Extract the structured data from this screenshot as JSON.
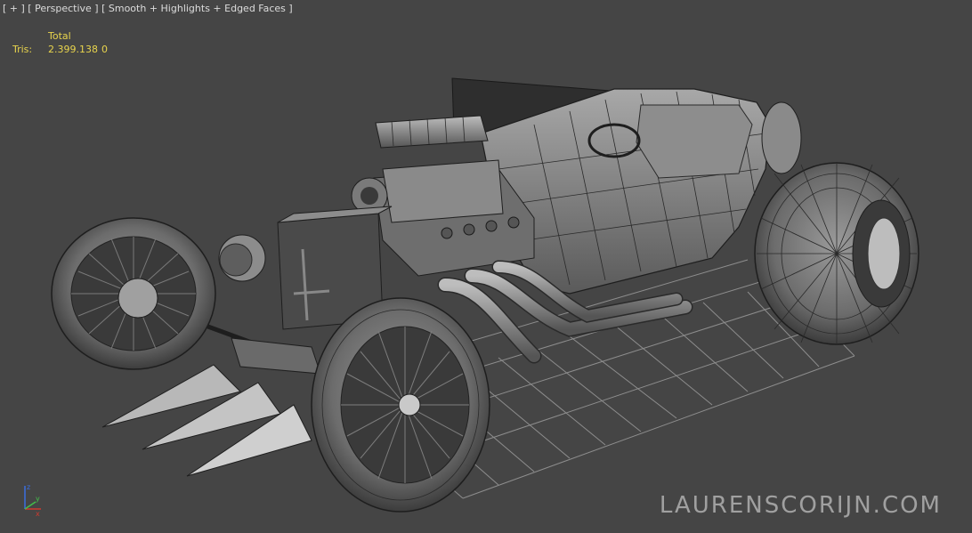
{
  "viewport": {
    "label": {
      "plus": "[ + ]",
      "view": "[ Perspective ]",
      "shading": "[ Smooth + Highlights + Edged Faces ]"
    },
    "stats": {
      "header": "Total",
      "tris_label": "Tris:",
      "tris_total": "2.399.138",
      "tris_selected": "0"
    },
    "axis": {
      "x": "x",
      "y": "y",
      "z": "z"
    },
    "watermark": "LAURENSCORIJN.COM"
  },
  "colors": {
    "background": "#454545",
    "grid": "#9a9a9a",
    "stats_text": "#e8d44d",
    "label_text": "#dcdcdc",
    "model_fill": "#7a7a7a",
    "wire": "#1e1e1e"
  }
}
